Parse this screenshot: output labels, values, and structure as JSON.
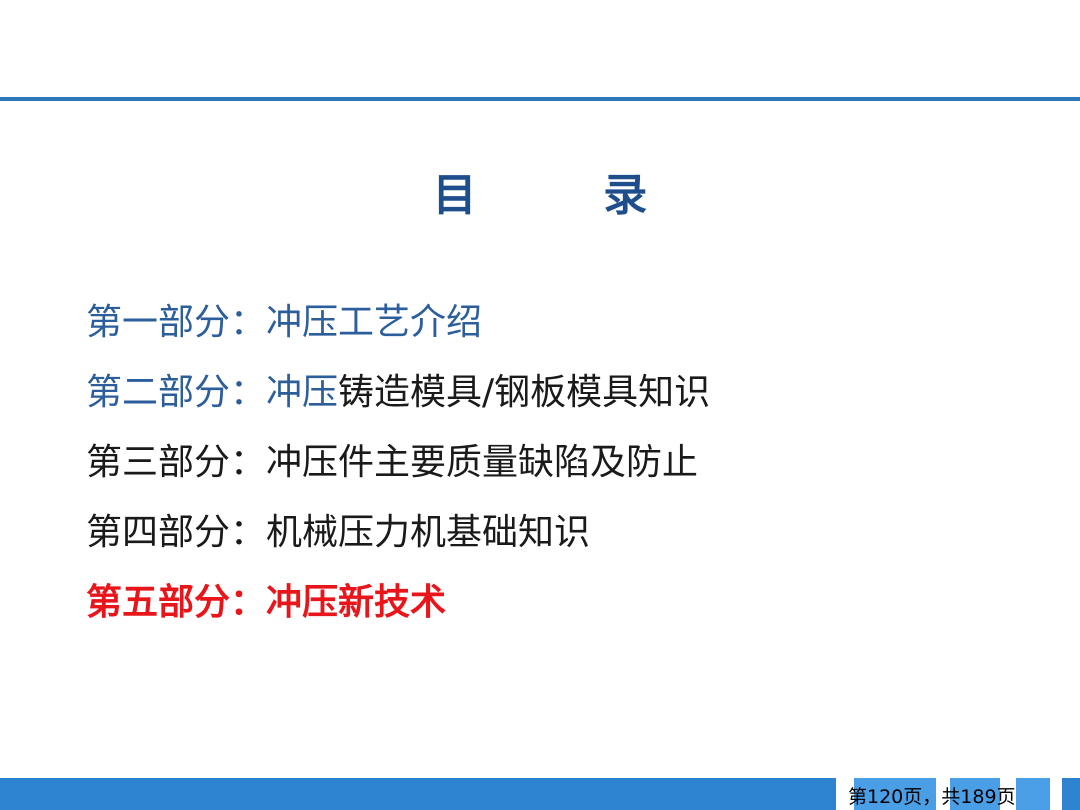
{
  "slide": {
    "title": "目  录",
    "title_color": "#1f4e8c",
    "accent_color": "#2d78b7",
    "toc": [
      {
        "part": "第一部分：",
        "topic": "冲压工艺介绍",
        "part_color": "#2d5e9c",
        "topic_color": "#2d5e9c",
        "highlight": "",
        "highlight_color": "",
        "active": false
      },
      {
        "part": "第二部分：",
        "topic": "冲压",
        "part_color": "#2d5e9c",
        "topic_color": "#2d5e9c",
        "highlight": "铸造模具/钢板模具知识",
        "highlight_color": "#1a1a1a",
        "active": false
      },
      {
        "part": "第三部分：",
        "topic": "冲压件主要质量缺陷及防止",
        "part_color": "#1a1a1a",
        "topic_color": "#1a1a1a",
        "highlight": "",
        "highlight_color": "",
        "active": false
      },
      {
        "part": "第四部分：",
        "topic": "机械压力机基础知识",
        "part_color": "#1a1a1a",
        "topic_color": "#1a1a1a",
        "highlight": "",
        "highlight_color": "",
        "active": false
      },
      {
        "part": "第五部分：",
        "topic": "冲压新技术",
        "part_color": "#e8161b",
        "topic_color": "#e8161b",
        "highlight": "",
        "highlight_color": "",
        "active": true
      }
    ],
    "footer": {
      "page_text": "第120页，共189页",
      "band_color": "#2d83d0"
    }
  }
}
